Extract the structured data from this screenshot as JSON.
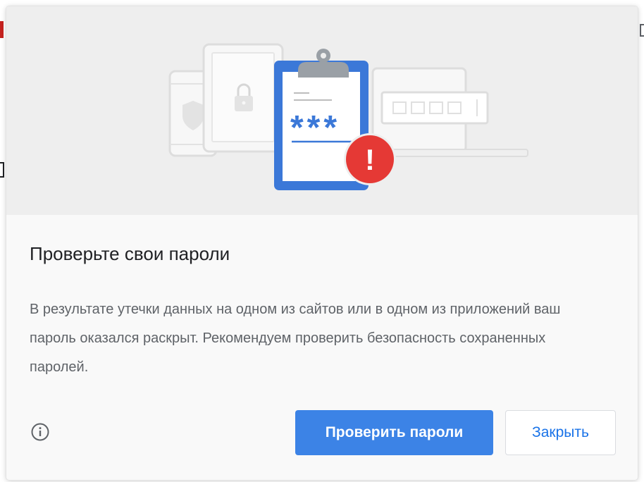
{
  "dialog": {
    "title": "Проверьте свои пароли",
    "description": "В результате утечки данных на одном из сайтов или в одном из приложений ваш пароль оказался раскрыт. Рекомендуем проверить безопасность сохраненных паролей.",
    "primary_button_label": "Проверить пароли",
    "secondary_button_label": "Закрыть",
    "info_icon": "info-icon",
    "illustration": {
      "password_mask": "***",
      "warning_symbol": "!",
      "icons": [
        "phone-shield-icon",
        "tablet-lock-icon",
        "clipboard-icon",
        "warning-icon",
        "laptop-icon"
      ]
    }
  },
  "colors": {
    "accent_blue": "#3c83e6",
    "link_blue": "#1a73e8",
    "warning_red": "#e53935",
    "clipboard_blue": "#3b78d8",
    "title_text": "#202124",
    "body_text": "#5f6368",
    "illustration_bg": "#eeeeee"
  }
}
